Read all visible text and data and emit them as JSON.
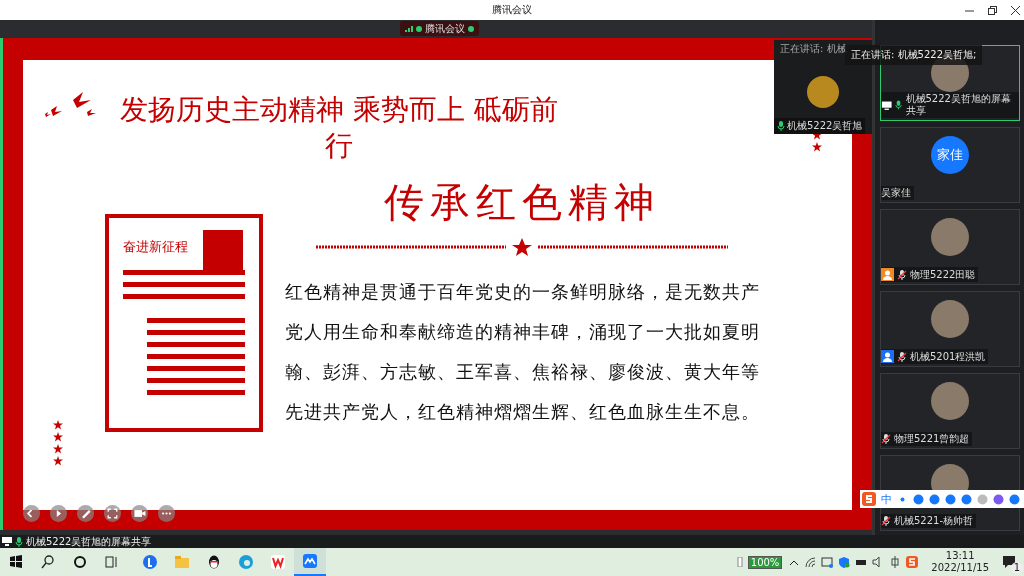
{
  "window": {
    "title": "腾讯会议"
  },
  "meeting_badge": {
    "label": "腾讯会议"
  },
  "slide": {
    "heading": "发扬历史主动精神 乘势而上 砥砺前行",
    "title": "传承红色精神",
    "document_label": "奋进新征程",
    "body": "红色精神是贯通于百年党史的一条鲜明脉络，是无数共产党人用生命和奉献缔造的精神丰碑，涌现了一大批如夏明翰、彭湃、方志敏、王军喜、焦裕禄、廖俊波、黄大年等先进共产党人，红色精神熠熠生辉、红色血脉生生不息。"
  },
  "thumbnail": {
    "status": "正在讲话: 机械",
    "name": "机械5222吴哲旭"
  },
  "speaker_overlay": {
    "text": "正在讲话: 机械5222吴哲旭;"
  },
  "participants": [
    {
      "kind": "share",
      "name": "机械5222吴哲旭的屏幕共享",
      "selected": true
    },
    {
      "kind": "initials",
      "name": "吴家佳",
      "initials": "家佳",
      "selected": false
    },
    {
      "kind": "member",
      "name": "物理5222田聪",
      "selected": false,
      "color": "#f08a24"
    },
    {
      "kind": "member",
      "name": "机械5201程洪凯",
      "selected": false,
      "color": "#1e6ff0"
    },
    {
      "kind": "member",
      "name": "物理5221曾韵超",
      "selected": false
    },
    {
      "kind": "member",
      "name": "机械5221-杨帅哲",
      "selected": false
    }
  ],
  "ime_bar": {
    "mode": "中"
  },
  "share_label": {
    "text": "机械5222吴哲旭的屏幕共享"
  },
  "taskbar": {
    "battery": "100%",
    "time": "13:11",
    "date": "2022/11/15",
    "notifications": "1"
  }
}
